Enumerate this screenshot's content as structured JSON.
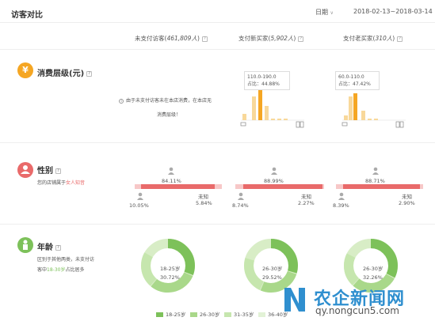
{
  "header": {
    "title": "访客对比",
    "date_type": "日期",
    "date_range": "2018-02-13~2018-03-14"
  },
  "columns": [
    {
      "label": "未支付访客",
      "count": "461,809人"
    },
    {
      "label": "支付新买家",
      "count": "5,902人"
    },
    {
      "label": "支付老买家",
      "count": "310人"
    }
  ],
  "sections": {
    "consumption": {
      "title": "消费层级(元)",
      "note_line1": "由于未支付访客未在本店消费，在本店无",
      "note_line2": "消费层级！",
      "tips": [
        {
          "range": "110.0-190.0",
          "share": "占比：44.88%"
        },
        {
          "range": "60.0-110.0",
          "share": "占比：47.42%"
        }
      ]
    },
    "gender": {
      "title": "性别",
      "desc_prefix": "您的店铺属于",
      "desc_highlight": "女人知音",
      "columns": [
        {
          "female": "84.11%",
          "male": "10.05%",
          "unknown_label": "未知",
          "unknown": "5.84%"
        },
        {
          "female": "88.99%",
          "male": "8.74%",
          "unknown_label": "未知",
          "unknown": "2.27%"
        },
        {
          "female": "88.71%",
          "male": "8.39%",
          "unknown_label": "未知",
          "unknown": "2.90%"
        }
      ]
    },
    "age": {
      "title": "年龄",
      "desc_line1": "区别于其他两类，未支付访",
      "desc_line2_prefix": "客中",
      "desc_line2_highlight": "18-30岁",
      "desc_line2_suffix": "占比居多",
      "donuts": [
        {
          "range": "18-25岁",
          "pct": "30.72%"
        },
        {
          "range": "26-30岁",
          "pct": "29.52%"
        },
        {
          "range": "26-30岁",
          "pct": "32.26%"
        }
      ],
      "legend": [
        "18-25岁",
        "26-30岁",
        "31-35岁",
        "36-40岁"
      ]
    }
  },
  "watermark": {
    "text": "农企新闻网",
    "sub": "qy.nongcun5.com"
  },
  "colors": {
    "consumption_icon": "#f5a623",
    "gender_icon": "#e96a6a",
    "age_icon": "#7dc15a",
    "highlight_red": "#e96a6a",
    "highlight_green": "#7dc15a",
    "bar_orange": "#f5a623",
    "bar_light": "#f8d89a"
  }
}
